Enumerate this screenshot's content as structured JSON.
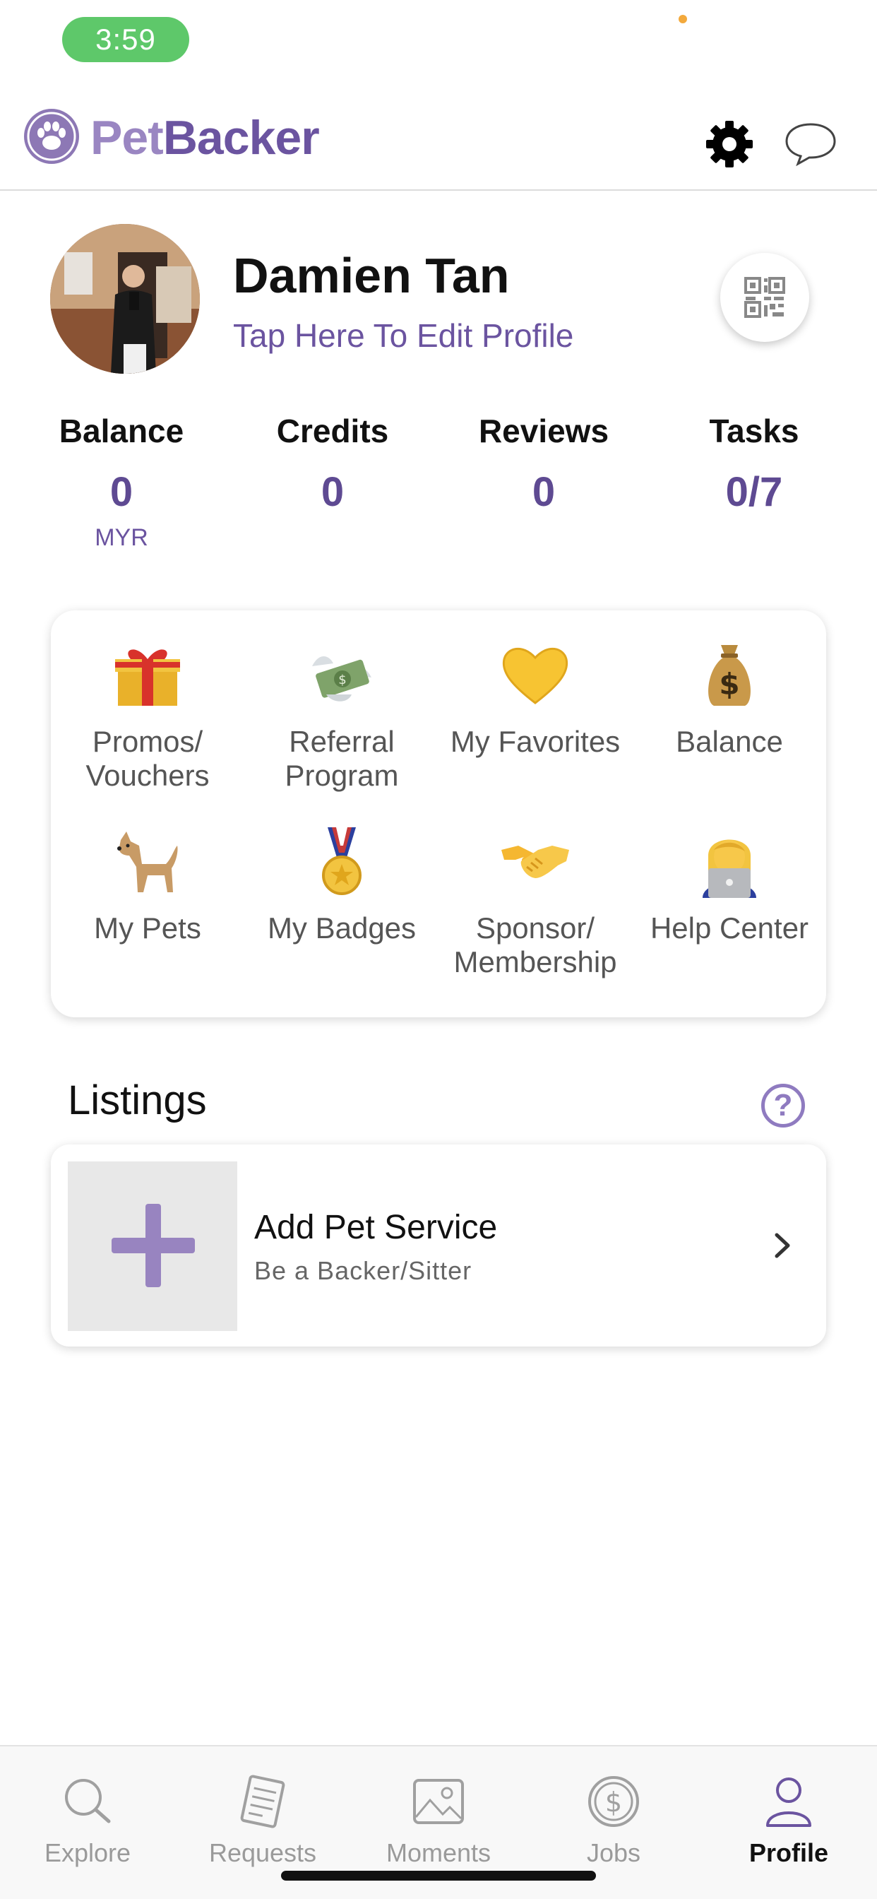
{
  "status_bar": {
    "time": "3:59"
  },
  "header": {
    "brand_part1": "Pet",
    "brand_part2": "Backer",
    "settings_icon": "gear-icon",
    "chat_icon": "chat-bubble-icon"
  },
  "profile": {
    "name": "Damien Tan",
    "edit_link": "Tap Here To Edit Profile",
    "qr_icon": "qr-code-icon"
  },
  "stats": [
    {
      "label": "Balance",
      "value": "0",
      "unit": "MYR"
    },
    {
      "label": "Credits",
      "value": "0"
    },
    {
      "label": "Reviews",
      "value": "0"
    },
    {
      "label": "Tasks",
      "value": "0/7"
    }
  ],
  "shortcuts": [
    {
      "label": "Promos/ Vouchers",
      "icon": "gift-icon"
    },
    {
      "label": "Referral Program",
      "icon": "money-with-wings-icon"
    },
    {
      "label": "My Favorites",
      "icon": "yellow-heart-icon"
    },
    {
      "label": "Balance",
      "icon": "money-bag-icon"
    },
    {
      "label": "My Pets",
      "icon": "dog-icon"
    },
    {
      "label": "My Badges",
      "icon": "medal-icon"
    },
    {
      "label": "Sponsor/ Membership",
      "icon": "handshake-icon"
    },
    {
      "label": "Help Center",
      "icon": "technologist-icon"
    }
  ],
  "listings": {
    "title": "Listings",
    "help_symbol": "?",
    "service_title": "Add Pet Service",
    "service_subtitle": "Be a Backer/Sitter"
  },
  "tabs": [
    {
      "label": "Explore",
      "icon": "search-icon",
      "active": false
    },
    {
      "label": "Requests",
      "icon": "document-icon",
      "active": false
    },
    {
      "label": "Moments",
      "icon": "image-icon",
      "active": false
    },
    {
      "label": "Jobs",
      "icon": "dollar-coin-icon",
      "active": false
    },
    {
      "label": "Profile",
      "icon": "user-icon",
      "active": true
    }
  ],
  "colors": {
    "brand_purple": "#6b54a0",
    "brand_light_purple": "#9a86c2",
    "status_green": "#5ec86a"
  }
}
